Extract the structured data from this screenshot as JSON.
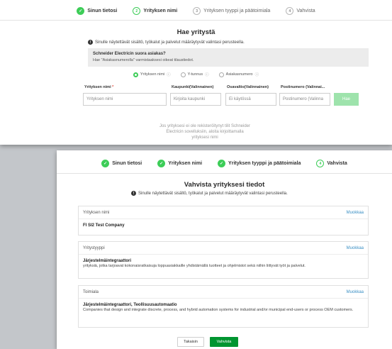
{
  "search_screen": {
    "steps": [
      {
        "label": "Sinun tietosi",
        "state": "done",
        "icon": "check-icon"
      },
      {
        "label": "Yrityksen nimi",
        "state": "current",
        "number": "2"
      },
      {
        "label": "Yrityksen tyyppi ja päätoimiala",
        "state": "todo",
        "number": "3"
      },
      {
        "label": "Vahvista",
        "state": "todo",
        "number": "4"
      }
    ],
    "title": "Hae yritystä",
    "info_text": "Sinulle näytettävät sisältö, työkalut ja palvelut määräytyvät valintasi perusteella.",
    "customer_question": "Schneider Electricin suora asiakas?",
    "customer_hint": "Hae \"Asiakasnumerolla\" varmistaaksesi oikeat tilaustiedot.",
    "radio_options": [
      {
        "label": "Yrityksen nimi",
        "selected": true
      },
      {
        "label": "Y-tunnus",
        "selected": false
      },
      {
        "label": "Asiakasnumero",
        "selected": false
      }
    ],
    "fields": [
      {
        "label": "Yrityksen nimi",
        "required_mark": "*",
        "placeholder": "Yrityksen nimi"
      },
      {
        "label": "Kaupunki(Valinnainen)",
        "placeholder": "Kirjoita kaupunki"
      },
      {
        "label": "Osavaltio(Valinnainen)",
        "placeholder": "Ei käytössä"
      },
      {
        "label": "Postinumero (Valinnai...",
        "placeholder": "Postinumero (Valinna"
      }
    ],
    "search_button": "Hae",
    "register_note": "Jos yrityksesi ei ole rekisteröitynyt tilit Schneider Electricin sovelluksiin, aloita kirjoittamalla yrityksesi nimi"
  },
  "confirm_screen": {
    "steps": [
      {
        "label": "Sinun tietosi",
        "state": "done"
      },
      {
        "label": "Yrityksen nimi",
        "state": "done"
      },
      {
        "label": "Yrityksen tyyppi ja päätoimiala",
        "state": "done"
      },
      {
        "label": "Vahvista",
        "state": "current",
        "number": "4"
      }
    ],
    "title": "Vahvista yrityksesi tiedot",
    "info_text": "Sinulle näytettävät sisältö, työkalut ja palvelut määräytyvät valintasi perusteella.",
    "company_card": {
      "title": "Yrityksen nimi",
      "edit": "Muokkaa",
      "value": "FI SI2 Test Company"
    },
    "type_card": {
      "title": "Yritystyyppi",
      "edit": "Muokkaa",
      "value": "Järjestelmäintegraattori",
      "description": "yrityksiä, jotka tarjoavat kokonaisratkaisuja loppuasiakkaille yhdistämällä tuotteet ja ohjelmistot sekä niihin liittyvät työt ja palvelut."
    },
    "industry_card": {
      "title": "Toimiala",
      "edit": "Muokkaa",
      "value": "Järjestelmäintegraattori, Teollisuusautomaatio",
      "description": "Companies that design and integrate discrete, process, and hybrid automation systems for industrial and/or municipal end-users or process OEM customers."
    },
    "back_button": "Takaisin",
    "confirm_button": "Vahvista"
  },
  "colors": {
    "accent_green": "#3dcd58",
    "confirm_green": "#009530",
    "link_blue": "#3a8fc4"
  }
}
